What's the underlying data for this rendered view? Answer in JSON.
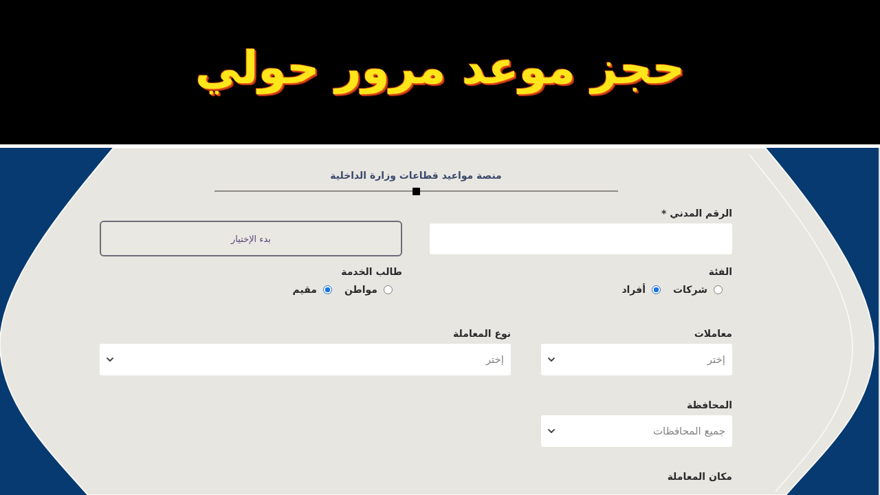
{
  "banner": {
    "title": "حجز موعد مرور حولي"
  },
  "form": {
    "heading": "منصة مواعيد قطاعات وزارة الداخلية",
    "rows": [
      {
        "fields": [
          {
            "kind": "text",
            "label": "الرقم المدني *"
          },
          {
            "kind": "button",
            "text": "بدء الإختيار"
          }
        ]
      },
      {
        "fields": [
          {
            "kind": "radio",
            "label": "الفئة",
            "options": [
              {
                "label": "شركات",
                "selected": false
              },
              {
                "label": "أفراد",
                "selected": true
              }
            ]
          },
          {
            "kind": "radio",
            "label": "طالب الخدمة",
            "options": [
              {
                "label": "مواطن",
                "selected": false
              },
              {
                "label": "مقيم",
                "selected": true
              }
            ]
          }
        ]
      },
      {
        "fields": [
          {
            "kind": "select",
            "label": "معاملات",
            "value": "إختر"
          },
          {
            "kind": "select",
            "label": "نوع المعاملة",
            "value": "إختر"
          }
        ]
      },
      {
        "fields": [
          {
            "kind": "select",
            "label": "المحافظة",
            "value": "جميع المحافظات"
          }
        ]
      },
      {
        "fields": [
          {
            "kind": "label",
            "label": "مكان المعاملة"
          }
        ]
      }
    ]
  }
}
